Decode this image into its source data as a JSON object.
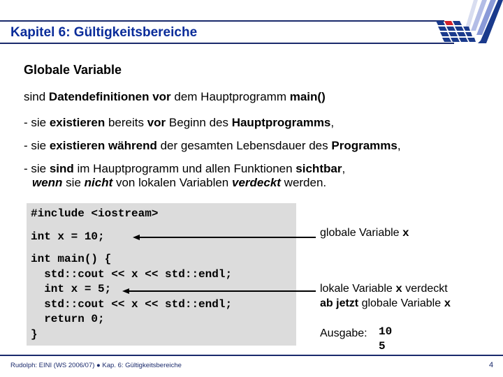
{
  "header": {
    "title": "Kapitel 6: Gültigkeitsbereiche",
    "accent_color": "#0a2c9a",
    "line_color": "#1a2a6c"
  },
  "logo": {
    "icon": "university-grid-logo-icon",
    "colors": [
      "#1a3a8c",
      "#d0202a",
      "#8a9ad8"
    ]
  },
  "slide": {
    "subtitle": "Globale Variable",
    "line1": {
      "p1": "sind ",
      "b1": "Datendefinitionen vor",
      "p2": " dem Hauptprogramm ",
      "b2": "main()"
    },
    "line2": {
      "p1": "- sie ",
      "b1": "existieren",
      "p2": " bereits ",
      "b2": "vor",
      "p3": " Beginn des ",
      "b3": "Hauptprogramms",
      "p4": ","
    },
    "line3": {
      "p1": "- sie ",
      "b1": "existieren während",
      "p2": " der gesamten Lebensdauer des ",
      "b2": "Programms",
      "p3": ","
    },
    "line4": {
      "p1": "- sie ",
      "b1": "sind",
      "p2": " im Hauptprogramm und allen Funktionen ",
      "b2": "sichtbar",
      "p3": ","
    },
    "line5": {
      "i1": "wenn",
      "p1": " sie ",
      "i2": "nicht",
      "p2": " von lokalen Variablen ",
      "i3": "verdeckt",
      "p3": " werden."
    }
  },
  "code": {
    "lines": [
      "#include <iostream>",
      "int x = 10;",
      "int main() {",
      "  std::cout << x << std::endl;",
      "  int x = 5;",
      "  std::cout << x << std::endl;",
      "  return 0;",
      "}"
    ]
  },
  "annotations": {
    "global": {
      "text": "globale Variable ",
      "var": "x"
    },
    "local": {
      "text1": "lokale Variable ",
      "var1": "x",
      "text2": " verdeckt",
      "bold": "ab jetzt",
      "text3": " globale Variable ",
      "var2": "x"
    },
    "output": {
      "label": "Ausgabe:",
      "values": [
        "10",
        "5"
      ]
    }
  },
  "footer": {
    "left": "Rudolph: EINI (WS 2006/07)  ●  Kap. 6: Gültigkeitsbereiche",
    "page": "4"
  }
}
